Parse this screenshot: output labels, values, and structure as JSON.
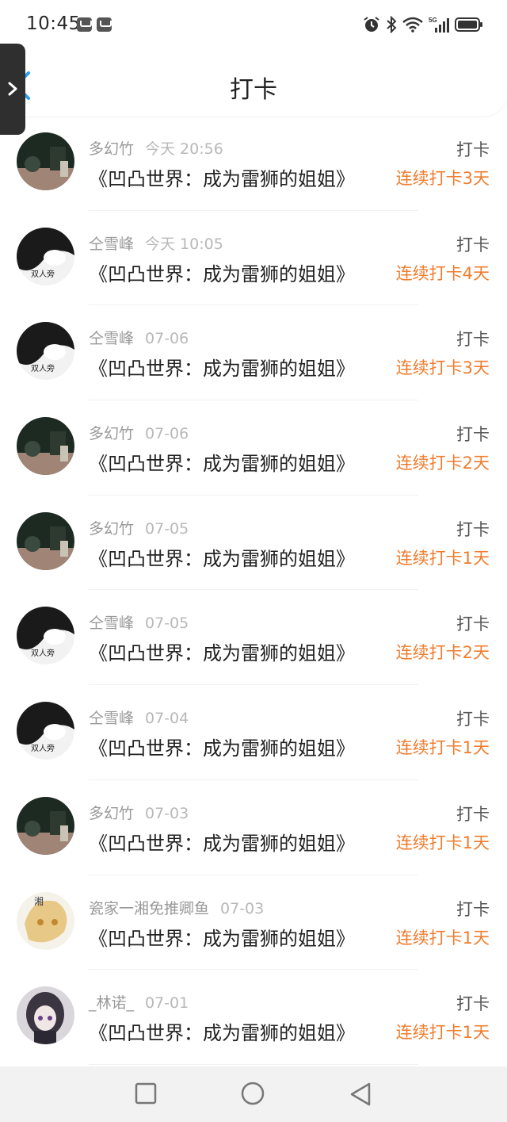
{
  "status_bar": {
    "time": "10:45",
    "icons": [
      "mail-icon",
      "mail-icon",
      "alarm-icon",
      "bluetooth-icon",
      "wifi-icon",
      "5g-signal-icon",
      "battery-icon"
    ]
  },
  "header": {
    "title": "打卡",
    "back_icon": "chevron-left-icon"
  },
  "floating_tab": {
    "icon": "chevron-right-icon"
  },
  "records": [
    {
      "name": "多幻竹",
      "date": "今天 20:56",
      "book": "《凹凸世界：成为雷狮的姐姐》",
      "action": "打卡",
      "streak": "连续打卡3天",
      "avatar": "dark"
    },
    {
      "name": "仝雪峰",
      "date": "今天 10:05",
      "book": "《凹凸世界：成为雷狮的姐姐》",
      "action": "打卡",
      "streak": "连续打卡4天",
      "avatar": "bw"
    },
    {
      "name": "仝雪峰",
      "date": "07-06",
      "book": "《凹凸世界：成为雷狮的姐姐》",
      "action": "打卡",
      "streak": "连续打卡3天",
      "avatar": "bw"
    },
    {
      "name": "多幻竹",
      "date": "07-06",
      "book": "《凹凸世界：成为雷狮的姐姐》",
      "action": "打卡",
      "streak": "连续打卡2天",
      "avatar": "dark"
    },
    {
      "name": "多幻竹",
      "date": "07-05",
      "book": "《凹凸世界：成为雷狮的姐姐》",
      "action": "打卡",
      "streak": "连续打卡1天",
      "avatar": "dark"
    },
    {
      "name": "仝雪峰",
      "date": "07-05",
      "book": "《凹凸世界：成为雷狮的姐姐》",
      "action": "打卡",
      "streak": "连续打卡2天",
      "avatar": "bw"
    },
    {
      "name": "仝雪峰",
      "date": "07-04",
      "book": "《凹凸世界：成为雷狮的姐姐》",
      "action": "打卡",
      "streak": "连续打卡1天",
      "avatar": "bw"
    },
    {
      "name": "多幻竹",
      "date": "07-03",
      "book": "《凹凸世界：成为雷狮的姐姐》",
      "action": "打卡",
      "streak": "连续打卡1天",
      "avatar": "dark"
    },
    {
      "name": "瓷家一湘免推卿鱼",
      "date": "07-03",
      "book": "《凹凸世界：成为雷狮的姐姐》",
      "action": "打卡",
      "streak": "连续打卡1天",
      "avatar": "anime"
    },
    {
      "name": "_林诺_",
      "date": "07-01",
      "book": "《凹凸世界：成为雷狮的姐姐》",
      "action": "打卡",
      "streak": "连续打卡1天",
      "avatar": "girl"
    }
  ],
  "avatar_text": {
    "bw": "双人旁",
    "anime": "湘"
  },
  "colors": {
    "streak": "#ef7d2f",
    "back_arrow": "#2a9df4",
    "name": "#999999",
    "title": "#222222"
  },
  "nav_bar": {
    "buttons": [
      "recents-square-icon",
      "home-circle-icon",
      "back-triangle-icon"
    ]
  }
}
